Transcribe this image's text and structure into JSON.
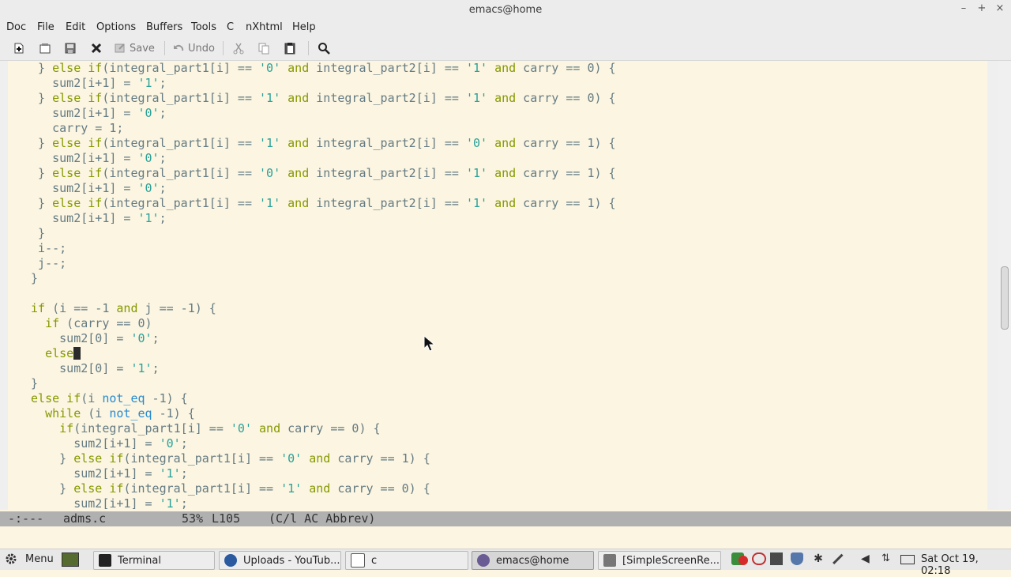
{
  "window": {
    "title": "emacs@home",
    "controls": [
      "–",
      "+",
      "×"
    ]
  },
  "menubar": [
    "Doc",
    "File",
    "Edit",
    "Options",
    "Buffers",
    "Tools",
    "C",
    "nXhtml",
    "Help"
  ],
  "toolbar": {
    "save_label": "Save",
    "undo_label": "Undo"
  },
  "editor": {
    "lines": [
      [
        [
          "  } ",
          ""
        ],
        [
          "else if",
          "kw"
        ],
        [
          "(integral_part1[i] == ",
          ""
        ],
        [
          "'0'",
          "str"
        ],
        [
          " ",
          ""
        ],
        [
          "and",
          "kw"
        ],
        [
          " integral_part2[i] == ",
          ""
        ],
        [
          "'1'",
          "str"
        ],
        [
          " ",
          ""
        ],
        [
          "and",
          "kw"
        ],
        [
          " carry == 0) {",
          ""
        ]
      ],
      [
        [
          "    sum2[i+1] = ",
          ""
        ],
        [
          "'1'",
          "str"
        ],
        [
          ";",
          ""
        ]
      ],
      [
        [
          "  } ",
          ""
        ],
        [
          "else if",
          "kw"
        ],
        [
          "(integral_part1[i] == ",
          ""
        ],
        [
          "'1'",
          "str"
        ],
        [
          " ",
          ""
        ],
        [
          "and",
          "kw"
        ],
        [
          " integral_part2[i] == ",
          ""
        ],
        [
          "'1'",
          "str"
        ],
        [
          " ",
          ""
        ],
        [
          "and",
          "kw"
        ],
        [
          " carry == 0) {",
          ""
        ]
      ],
      [
        [
          "    sum2[i+1] = ",
          ""
        ],
        [
          "'0'",
          "str"
        ],
        [
          ";",
          ""
        ]
      ],
      [
        [
          "    carry = 1;",
          ""
        ]
      ],
      [
        [
          "  } ",
          ""
        ],
        [
          "else if",
          "kw"
        ],
        [
          "(integral_part1[i] == ",
          ""
        ],
        [
          "'1'",
          "str"
        ],
        [
          " ",
          ""
        ],
        [
          "and",
          "kw"
        ],
        [
          " integral_part2[i] == ",
          ""
        ],
        [
          "'0'",
          "str"
        ],
        [
          " ",
          ""
        ],
        [
          "and",
          "kw"
        ],
        [
          " carry == 1) {",
          ""
        ]
      ],
      [
        [
          "    sum2[i+1] = ",
          ""
        ],
        [
          "'0'",
          "str"
        ],
        [
          ";",
          ""
        ]
      ],
      [
        [
          "  } ",
          ""
        ],
        [
          "else if",
          "kw"
        ],
        [
          "(integral_part1[i] == ",
          ""
        ],
        [
          "'0'",
          "str"
        ],
        [
          " ",
          ""
        ],
        [
          "and",
          "kw"
        ],
        [
          " integral_part2[i] == ",
          ""
        ],
        [
          "'1'",
          "str"
        ],
        [
          " ",
          ""
        ],
        [
          "and",
          "kw"
        ],
        [
          " carry == 1) {",
          ""
        ]
      ],
      [
        [
          "    sum2[i+1] = ",
          ""
        ],
        [
          "'0'",
          "str"
        ],
        [
          ";",
          ""
        ]
      ],
      [
        [
          "  } ",
          ""
        ],
        [
          "else if",
          "kw"
        ],
        [
          "(integral_part1[i] == ",
          ""
        ],
        [
          "'1'",
          "str"
        ],
        [
          " ",
          ""
        ],
        [
          "and",
          "kw"
        ],
        [
          " integral_part2[i] == ",
          ""
        ],
        [
          "'1'",
          "str"
        ],
        [
          " ",
          ""
        ],
        [
          "and",
          "kw"
        ],
        [
          " carry == 1) {",
          ""
        ]
      ],
      [
        [
          "    sum2[i+1] = ",
          ""
        ],
        [
          "'1'",
          "str"
        ],
        [
          ";",
          ""
        ]
      ],
      [
        [
          "  }",
          ""
        ]
      ],
      [
        [
          "  i--;",
          ""
        ]
      ],
      [
        [
          "  j--;",
          ""
        ]
      ],
      [
        [
          " }",
          ""
        ]
      ],
      [
        [
          "",
          ""
        ]
      ],
      [
        [
          " ",
          ""
        ],
        [
          "if",
          "kw"
        ],
        [
          " (i == -1 ",
          ""
        ],
        [
          "and",
          "kw"
        ],
        [
          " j == -1) {",
          ""
        ]
      ],
      [
        [
          "   ",
          ""
        ],
        [
          "if",
          "kw"
        ],
        [
          " (carry == 0)",
          ""
        ]
      ],
      [
        [
          "     sum2[0] = ",
          ""
        ],
        [
          "'0'",
          "str"
        ],
        [
          ";",
          ""
        ]
      ],
      [
        [
          "   ",
          ""
        ],
        [
          "else",
          "kw"
        ],
        [
          "",
          ""
        ]
      ],
      [
        [
          "     sum2[0] = ",
          ""
        ],
        [
          "'1'",
          "str"
        ],
        [
          ";",
          ""
        ]
      ],
      [
        [
          " }",
          ""
        ]
      ],
      [
        [
          " ",
          ""
        ],
        [
          "else if",
          "kw"
        ],
        [
          "(i ",
          ""
        ],
        [
          "not_eq",
          "op"
        ],
        [
          " -1) {",
          ""
        ]
      ],
      [
        [
          "   ",
          ""
        ],
        [
          "while",
          "kw"
        ],
        [
          " (i ",
          ""
        ],
        [
          "not_eq",
          "op"
        ],
        [
          " -1) {",
          ""
        ]
      ],
      [
        [
          "     ",
          ""
        ],
        [
          "if",
          "kw"
        ],
        [
          "(integral_part1[i] == ",
          ""
        ],
        [
          "'0'",
          "str"
        ],
        [
          " ",
          ""
        ],
        [
          "and",
          "kw"
        ],
        [
          " carry == 0) {",
          ""
        ]
      ],
      [
        [
          "       sum2[i+1] = ",
          ""
        ],
        [
          "'0'",
          "str"
        ],
        [
          ";",
          ""
        ]
      ],
      [
        [
          "     } ",
          ""
        ],
        [
          "else if",
          "kw"
        ],
        [
          "(integral_part1[i] == ",
          ""
        ],
        [
          "'0'",
          "str"
        ],
        [
          " ",
          ""
        ],
        [
          "and",
          "kw"
        ],
        [
          " carry == 1) {",
          ""
        ]
      ],
      [
        [
          "       sum2[i+1] = ",
          ""
        ],
        [
          "'1'",
          "str"
        ],
        [
          ";",
          ""
        ]
      ],
      [
        [
          "     } ",
          ""
        ],
        [
          "else if",
          "kw"
        ],
        [
          "(integral_part1[i] == ",
          ""
        ],
        [
          "'1'",
          "str"
        ],
        [
          " ",
          ""
        ],
        [
          "and",
          "kw"
        ],
        [
          " carry == 0) {",
          ""
        ]
      ],
      [
        [
          "       sum2[i+1] = ",
          ""
        ],
        [
          "'1'",
          "str"
        ],
        [
          ";",
          ""
        ]
      ]
    ],
    "cursor_line": 19,
    "scroll_fraction": 0.53
  },
  "modeline": {
    "status": "-:---",
    "buffer": "adms.c",
    "position": "53%",
    "line": "L105",
    "mode": "(C/l AC Abbrev)"
  },
  "taskbar": {
    "menu_label": "Menu",
    "tasks": [
      "Terminal",
      "Uploads - YouTub...",
      "c",
      "emacs@home",
      "[SimpleScreenRe..."
    ],
    "active_task": 3,
    "clock": "Sat Oct 19, 02:18"
  },
  "colors": {
    "background": "#fbf5e1",
    "keyword": "#859900",
    "string": "#2aa198",
    "operator": "#268bd2",
    "text": "#657b83",
    "modeline": "#b0b0b0"
  }
}
